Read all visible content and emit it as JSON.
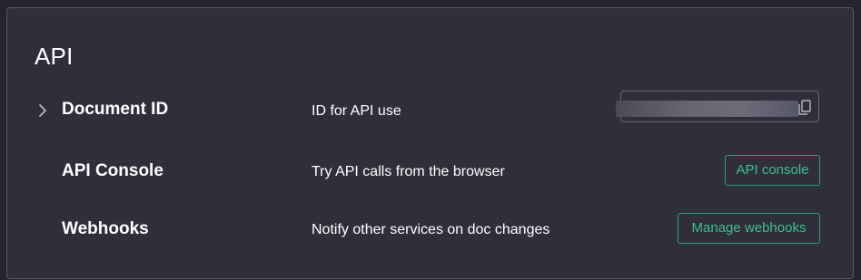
{
  "section": {
    "title": "API"
  },
  "rows": [
    {
      "name": "Document ID",
      "description": "ID for API use",
      "expand_icon": "chevron-right-icon",
      "copy_icon": "copy-icon"
    },
    {
      "name": "API Console",
      "description": "Try API calls from the browser",
      "button_label": "API console"
    },
    {
      "name": "Webhooks",
      "description": "Notify other services on doc changes",
      "button_label": "Manage webhooks"
    }
  ],
  "colors": {
    "background": "#24242f",
    "panel": "#2f2f3c",
    "border": "#5a5a66",
    "accent": "#3fbf8a",
    "text": "#ffffff"
  }
}
